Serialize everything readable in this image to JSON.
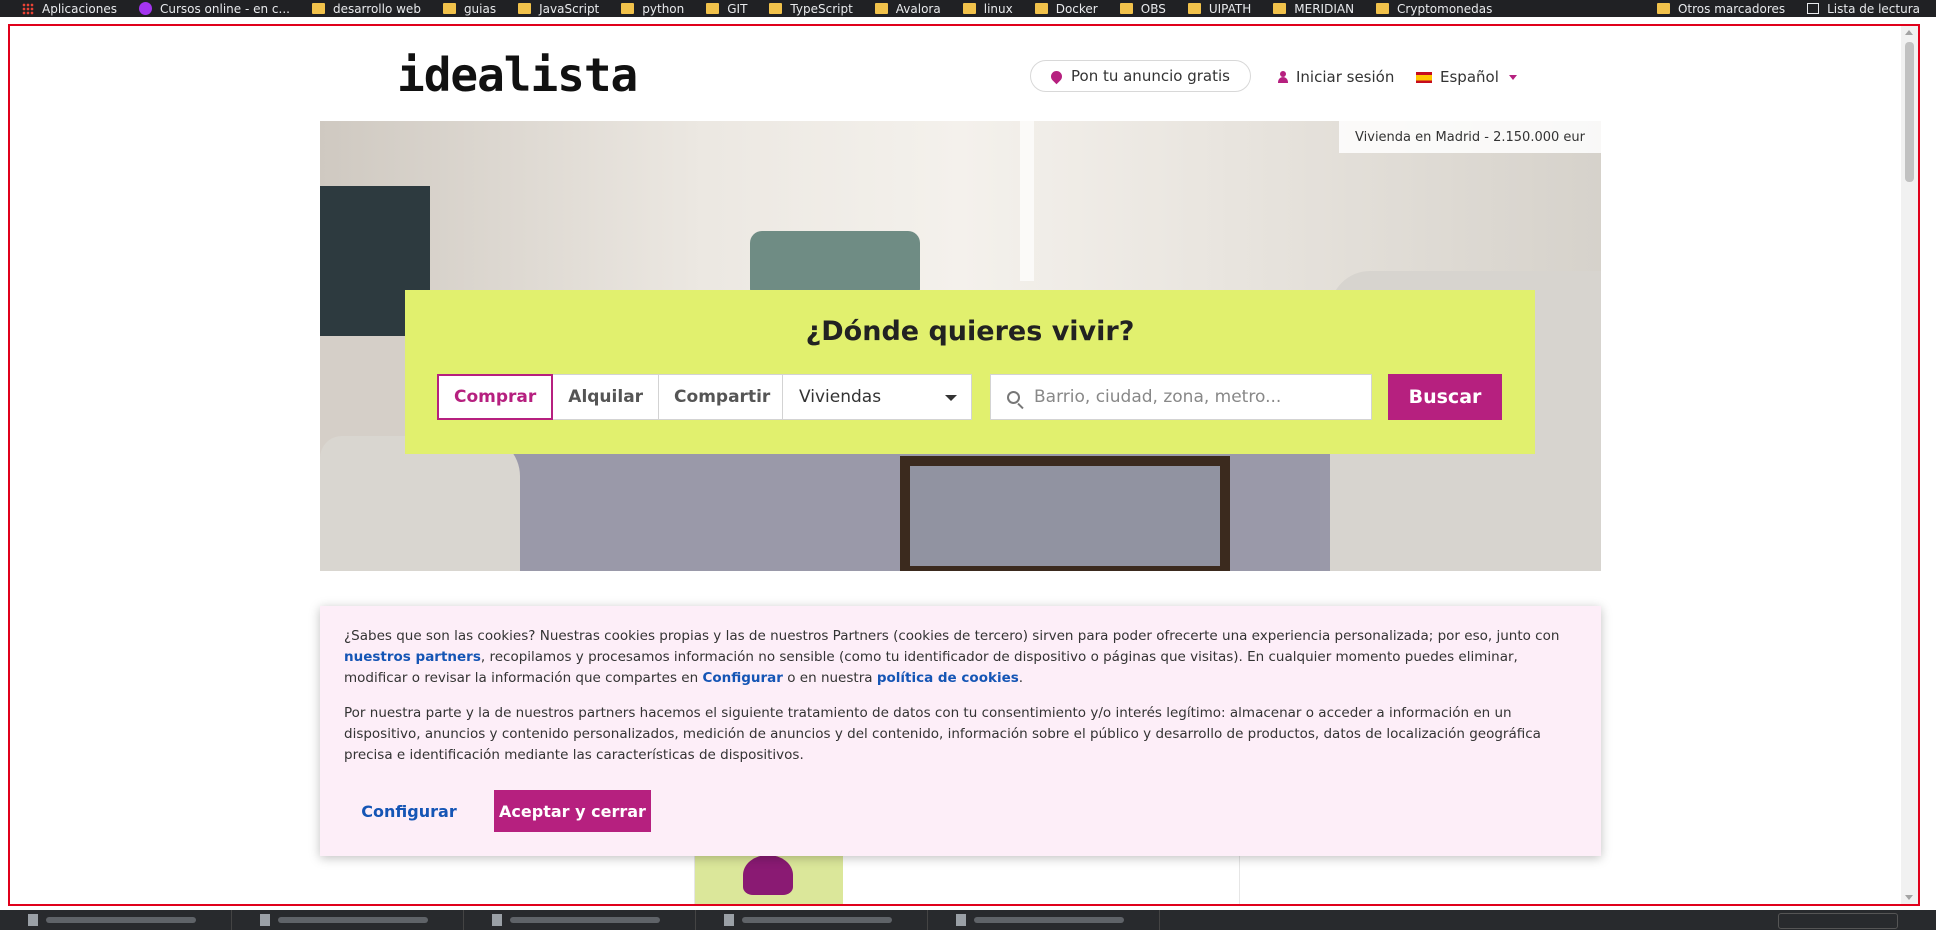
{
  "bookmarks": {
    "items": [
      {
        "label": "Aplicaciones",
        "icon": "apps-grid-icon"
      },
      {
        "label": "Cursos online - en c...",
        "icon": "udemy-icon"
      },
      {
        "label": "desarrollo web",
        "icon": "folder-icon"
      },
      {
        "label": "guias",
        "icon": "folder-icon"
      },
      {
        "label": "JavaScript",
        "icon": "folder-icon"
      },
      {
        "label": "python",
        "icon": "folder-icon"
      },
      {
        "label": "GIT",
        "icon": "folder-icon"
      },
      {
        "label": "TypeScript",
        "icon": "folder-icon"
      },
      {
        "label": "Avalora",
        "icon": "folder-icon"
      },
      {
        "label": "linux",
        "icon": "folder-icon"
      },
      {
        "label": "Docker",
        "icon": "folder-icon"
      },
      {
        "label": "OBS",
        "icon": "folder-icon"
      },
      {
        "label": "UIPATH",
        "icon": "folder-icon"
      },
      {
        "label": "MERIDIAN",
        "icon": "folder-icon"
      },
      {
        "label": "Cryptomonedas",
        "icon": "folder-icon"
      }
    ],
    "other": "Otros marcadores",
    "reading_list": "Lista de lectura"
  },
  "header": {
    "logo": "idealista",
    "post_ad": "Pon tu anuncio gratis",
    "login": "Iniciar sesión",
    "language": "Español"
  },
  "hero": {
    "photo_caption": "Vivienda en Madrid - 2.150.000 eur"
  },
  "search": {
    "title": "¿Dónde quieres vivir?",
    "tabs": [
      {
        "label": "Comprar",
        "active": true
      },
      {
        "label": "Alquilar",
        "active": false
      },
      {
        "label": "Compartir",
        "active": false
      }
    ],
    "property_type": "Viviendas",
    "placeholder": "Barrio, ciudad, zona, metro...",
    "button": "Buscar"
  },
  "cookie": {
    "p1_a": "¿Sabes que son las cookies? Nuestras cookies propias y las de nuestros Partners (cookies de tercero) sirven para poder ofrecerte una experiencia personalizada; por eso, junto con ",
    "p1_link1": "nuestros partners",
    "p1_b": ", recopilamos y procesamos información no sensible (como tu identificador de dispositivo o páginas que visitas). En cualquier momento puedes eliminar, modificar o revisar la información que compartes en ",
    "p1_link2": "Configurar",
    "p1_c": " o en nuestra ",
    "p1_link3": "política de cookies",
    "p1_d": ".",
    "p2": "Por nuestra parte y la de nuestros partners hacemos el siguiente tratamiento de datos con tu consentimiento y/o interés legítimo: almacenar o acceder a información en un dispositivo, anuncios y contenido personalizados, medición de anuncios y del contenido, información sobre el público y desarrollo de productos, datos de localización geográfica precisa e identificación mediante las características de dispositivos.",
    "configure_button": "Configurar",
    "accept_button": "Aceptar y cerrar"
  },
  "colors": {
    "brand": "#b6207f",
    "search_bg": "#e1f06e",
    "cookie_bg": "#fdeef8",
    "link": "#1555b5"
  }
}
